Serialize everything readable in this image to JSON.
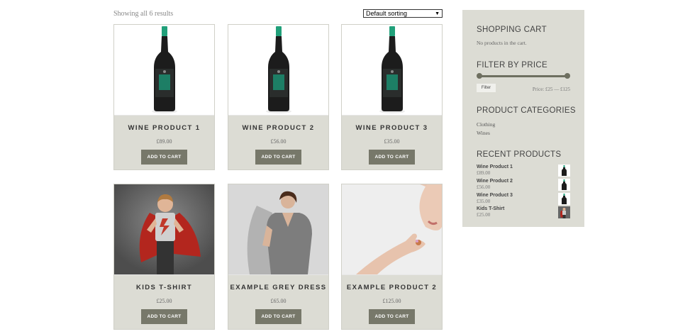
{
  "toolbar": {
    "result_count": "Showing all 6 results",
    "sort_value": "Default sorting"
  },
  "products": [
    {
      "title": "WINE PRODUCT 1",
      "price": "£89.00",
      "button": "ADD TO CART",
      "image": "wine-bottle"
    },
    {
      "title": "WINE PRODUCT 2",
      "price": "£56.00",
      "button": "ADD TO CART",
      "image": "wine-bottle"
    },
    {
      "title": "WINE PRODUCT 3",
      "price": "£35.00",
      "button": "ADD TO CART",
      "image": "wine-bottle"
    },
    {
      "title": "KIDS T-SHIRT",
      "price": "£25.00",
      "button": "ADD TO CART",
      "image": "kid-in-cape"
    },
    {
      "title": "EXAMPLE GREY DRESS",
      "price": "£65.00",
      "button": "ADD TO CART",
      "image": "woman-grey-dress"
    },
    {
      "title": "EXAMPLE PRODUCT 2",
      "price": "£125.00",
      "button": "ADD TO CART",
      "image": "hand-with-ring"
    }
  ],
  "sidebar": {
    "cart": {
      "heading": "SHOPPING CART",
      "empty_text": "No products in the cart."
    },
    "filter": {
      "heading": "FILTER BY PRICE",
      "button": "Filter",
      "range": "Price: £25 — £125"
    },
    "categories": {
      "heading": "PRODUCT CATEGORIES",
      "items": [
        "Clothing",
        "Wines"
      ]
    },
    "recent": {
      "heading": "RECENT PRODUCTS",
      "items": [
        {
          "name": "Wine Product 1",
          "price": "£89.00",
          "thumb": "wine-bottle"
        },
        {
          "name": "Wine Product 2",
          "price": "£56.00",
          "thumb": "wine-bottle"
        },
        {
          "name": "Wine Product 3",
          "price": "£35.00",
          "thumb": "wine-bottle"
        },
        {
          "name": "Kids T-Shirt",
          "price": "£25.00",
          "thumb": "kid-in-cape"
        }
      ]
    }
  },
  "colors": {
    "panel": "#dcdcd4",
    "button": "#77786a",
    "label_teal": "#1a9a78"
  }
}
